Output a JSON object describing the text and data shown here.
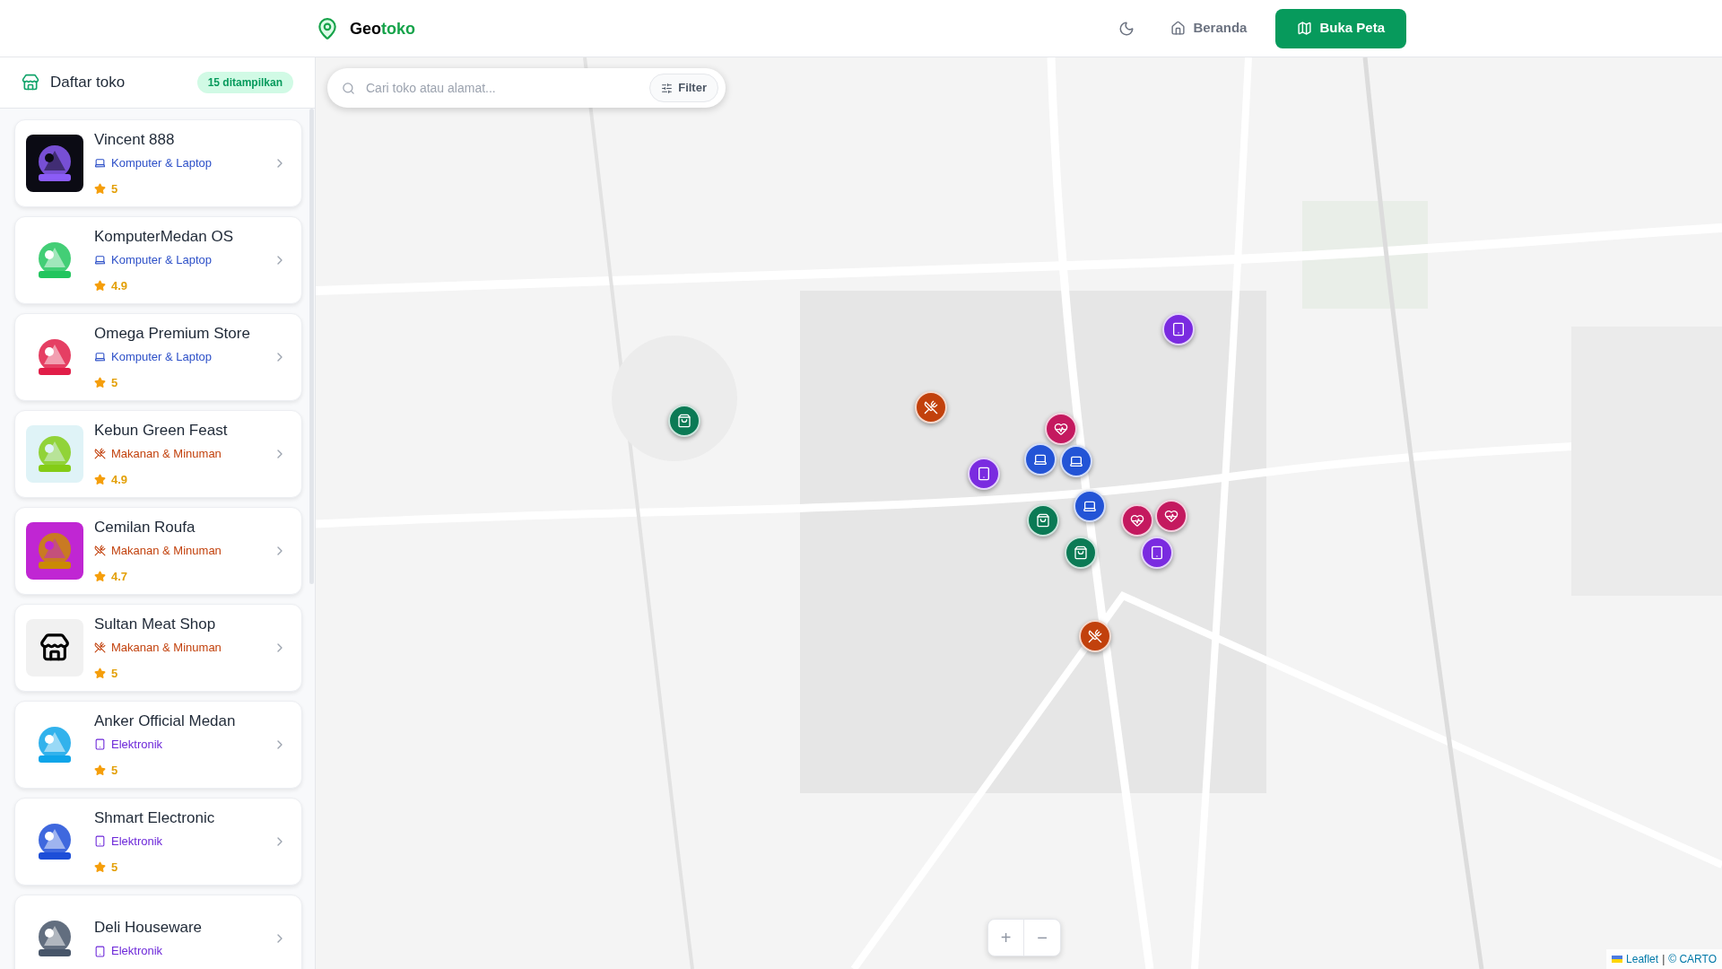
{
  "brand": {
    "prefix": "Geo",
    "suffix": "toko"
  },
  "nav": {
    "home": "Beranda",
    "open_map": "Buka Peta"
  },
  "sidebar": {
    "title": "Daftar toko",
    "count_badge": "15 ditampilkan",
    "stores": [
      {
        "name": "Vincent 888",
        "category": {
          "kind": "computer",
          "label": "Komputer & Laptop"
        },
        "rating": "5"
      },
      {
        "name": "KomputerMedan OS",
        "category": {
          "kind": "computer",
          "label": "Komputer & Laptop"
        },
        "rating": "4.9"
      },
      {
        "name": "Omega Premium Store",
        "category": {
          "kind": "computer",
          "label": "Komputer & Laptop"
        },
        "rating": "5"
      },
      {
        "name": "Kebun Green Feast",
        "category": {
          "kind": "food",
          "label": "Makanan & Minuman"
        },
        "rating": "4.9"
      },
      {
        "name": "Cemilan Roufa",
        "category": {
          "kind": "food",
          "label": "Makanan & Minuman"
        },
        "rating": "4.7"
      },
      {
        "name": "Sultan Meat Shop",
        "category": {
          "kind": "food",
          "label": "Makanan & Minuman"
        },
        "rating": "5",
        "logo": {
          "kind": "placeholder"
        }
      },
      {
        "name": "Anker Official Medan",
        "category": {
          "kind": "electronics",
          "label": "Elektronik"
        },
        "rating": "5"
      },
      {
        "name": "Shmart Electronic",
        "category": {
          "kind": "electronics",
          "label": "Elektronik"
        },
        "rating": "5"
      },
      {
        "name": "Deli Houseware",
        "category": {
          "kind": "electronics",
          "label": "Elektronik"
        }
      }
    ]
  },
  "map": {
    "search": {
      "placeholder": "Cari toko atau alamat...",
      "filter": "Filter"
    },
    "markers": [
      {
        "kind": "shop"
      },
      {
        "kind": "food"
      },
      {
        "kind": "electronics"
      },
      {
        "kind": "health"
      },
      {
        "kind": "computer"
      },
      {
        "kind": "computer"
      },
      {
        "kind": "electronics"
      },
      {
        "kind": "computer"
      },
      {
        "kind": "shop"
      },
      {
        "kind": "shop"
      },
      {
        "kind": "health"
      },
      {
        "kind": "health"
      },
      {
        "kind": "electronics"
      },
      {
        "kind": "food"
      }
    ],
    "zoom": {
      "in": "+",
      "out": "−",
      "disabled": true
    },
    "attribution": {
      "library": "Leaflet",
      "separator": "|",
      "provider": "© CARTO"
    }
  }
}
